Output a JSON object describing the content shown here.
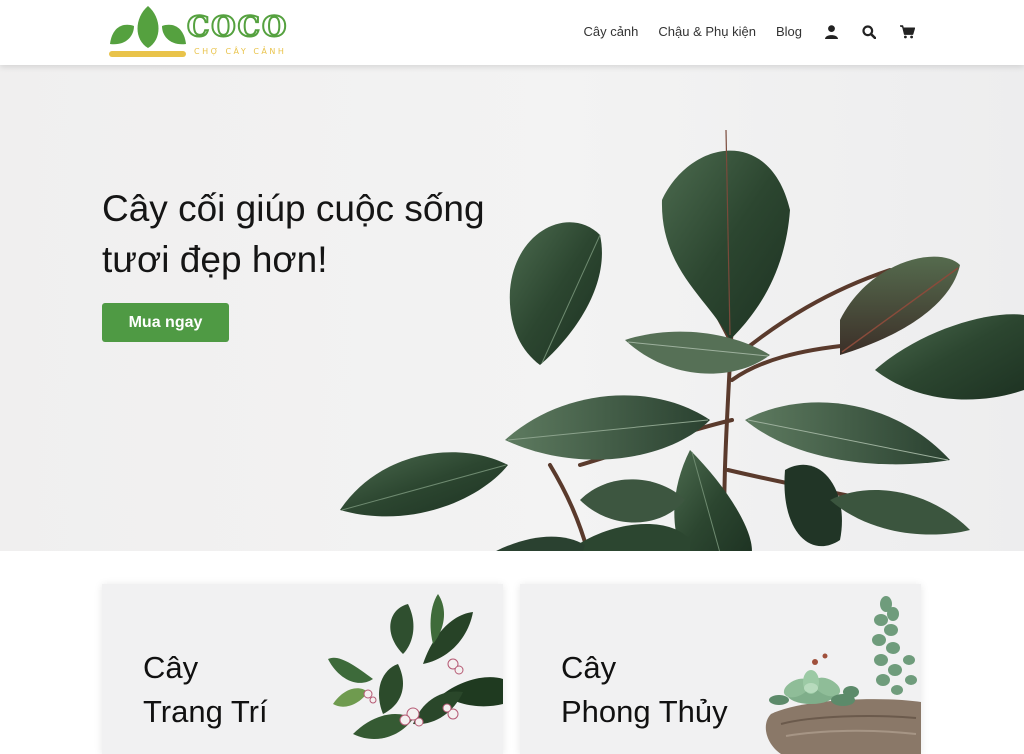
{
  "header": {
    "logo": {
      "name": "COCO",
      "tagline": "CHỢ CÂY CẢNH"
    },
    "nav": [
      {
        "label": "Cây cảnh"
      },
      {
        "label": "Chậu & Phụ kiện"
      },
      {
        "label": "Blog"
      }
    ],
    "icons": [
      "user-icon",
      "search-icon",
      "cart-icon"
    ]
  },
  "hero": {
    "title_line1": "Cây cối giúp cuộc sống",
    "title_line2": "tươi đẹp hơn!",
    "cta": "Mua ngay"
  },
  "categories": [
    {
      "line1": "Cây",
      "line2": "Trang Trí"
    },
    {
      "line1": "Cây",
      "line2": "Phong Thủy"
    }
  ],
  "colors": {
    "brand_green": "#55a13f",
    "button_green": "#4f9a44",
    "logo_yellow": "#e9c34a",
    "leaf_dark": "#2f4a32"
  }
}
